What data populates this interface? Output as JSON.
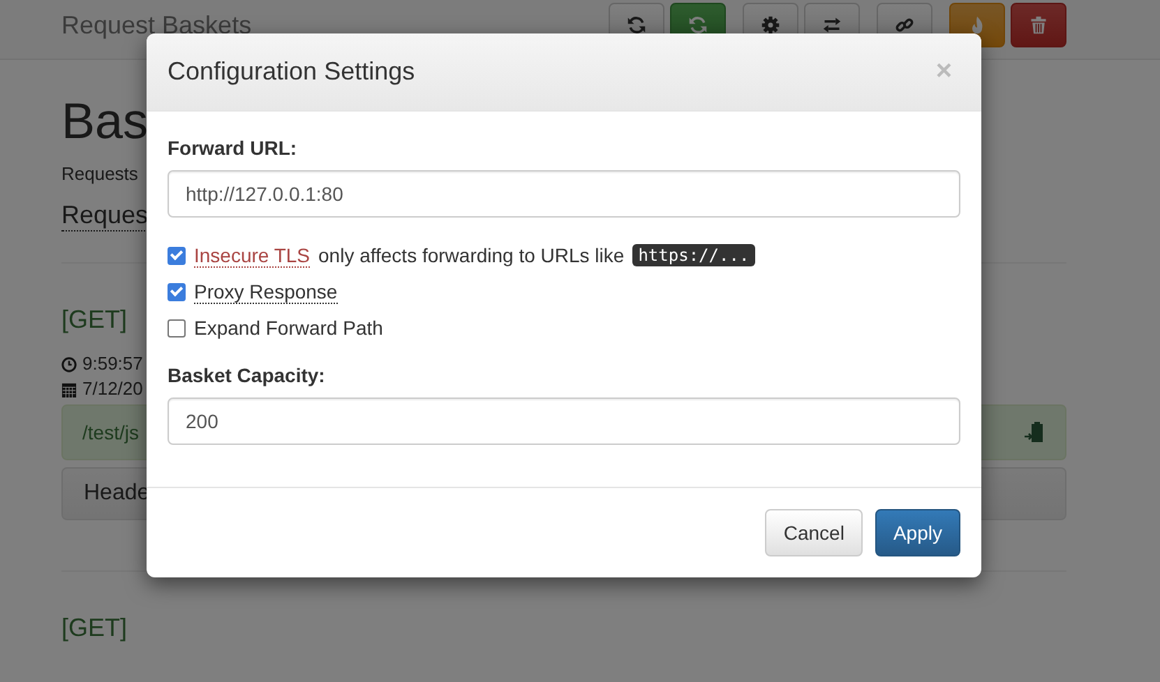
{
  "navbar": {
    "brand": "Request Baskets",
    "buttons": [
      {
        "kind": "refresh"
      },
      {
        "kind": "autorefresh"
      },
      {
        "kind": "settings"
      },
      {
        "kind": "responses"
      },
      {
        "kind": "share"
      },
      {
        "kind": "clear"
      },
      {
        "kind": "destroy"
      }
    ]
  },
  "page": {
    "heading": "Bas",
    "subtitle": "Requests",
    "link": "Reques",
    "requests": [
      {
        "method": "[GET]",
        "time": "9:59:57",
        "date": "7/12/20",
        "path": "/test/js",
        "tab": "Heade"
      },
      {
        "method": "[GET]"
      }
    ]
  },
  "modal": {
    "title": "Configuration Settings",
    "close": "×",
    "forward_url": {
      "label": "Forward URL:",
      "value": "http://127.0.0.1:80"
    },
    "options": [
      {
        "kind": "danger-hint",
        "label": "Insecure TLS",
        "note": "only affects forwarding to URLs like",
        "code": "https://...",
        "checked": true
      },
      {
        "kind": "hint",
        "label": "Proxy Response",
        "checked": true
      },
      {
        "kind": "plain",
        "label": "Expand Forward Path",
        "checked": false
      }
    ],
    "capacity": {
      "label": "Basket Capacity:",
      "value": "200"
    },
    "buttons": [
      {
        "label": "Cancel",
        "kind": "cancel"
      },
      {
        "label": "Apply",
        "kind": "apply"
      }
    ]
  }
}
